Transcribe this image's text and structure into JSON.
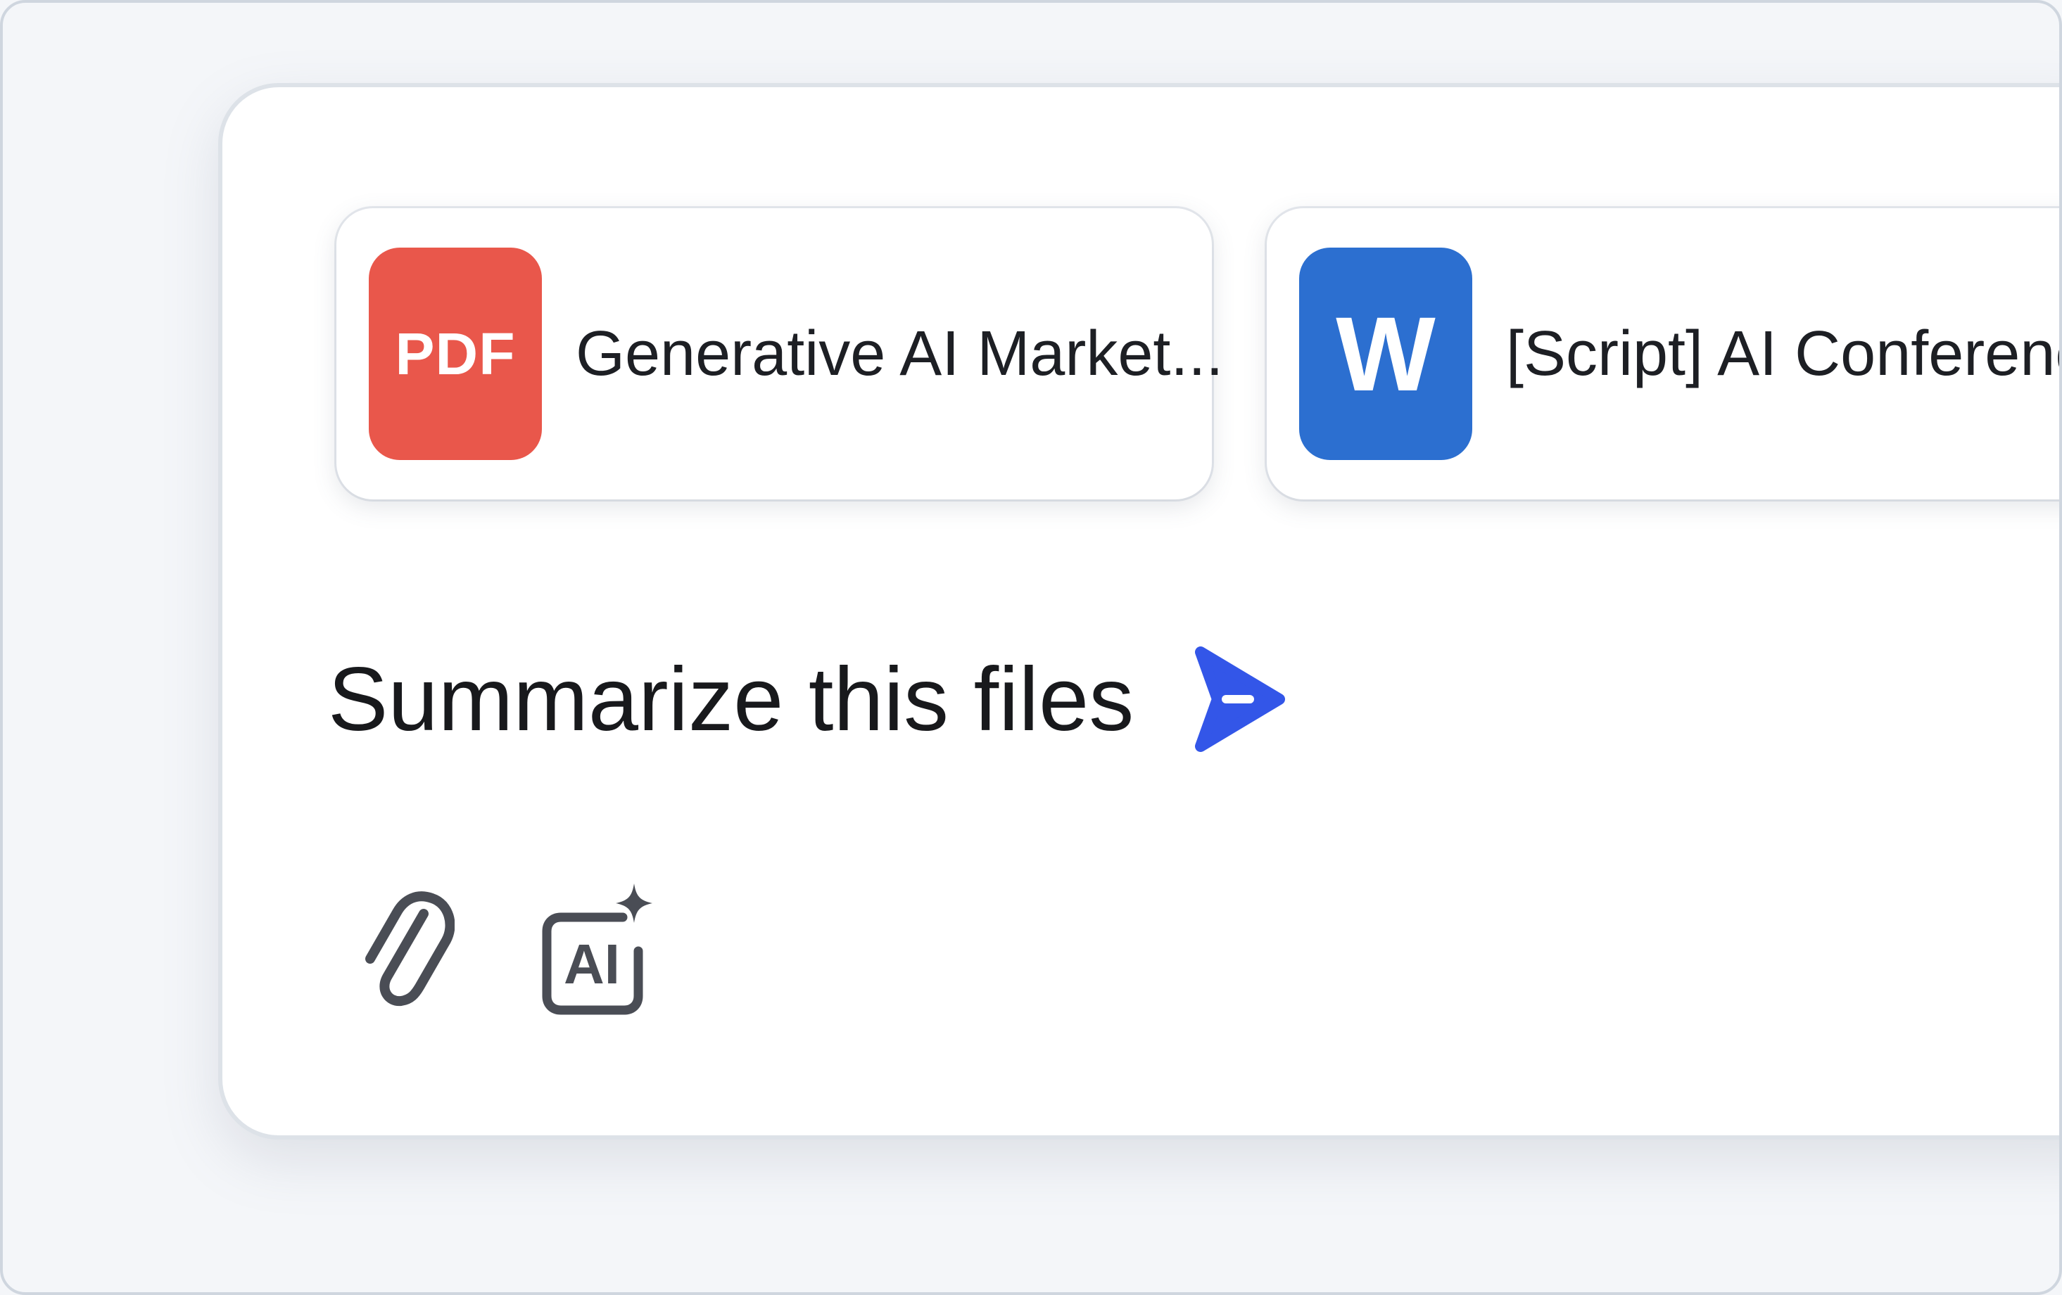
{
  "attachments": [
    {
      "type_label": "PDF",
      "name": "Generative AI Market...",
      "color": "#e9574b"
    },
    {
      "type_label": "W",
      "name": "[Script] AI Conference",
      "color": "#2c6fd0"
    }
  ],
  "prompt": {
    "text": "Summarize this files"
  },
  "send": {
    "icon": "send-icon",
    "color": "#3356e8"
  },
  "tools": {
    "attach_icon": "paperclip-icon",
    "ai_icon": "ai-sparkle-icon",
    "ai_label": "AI"
  }
}
